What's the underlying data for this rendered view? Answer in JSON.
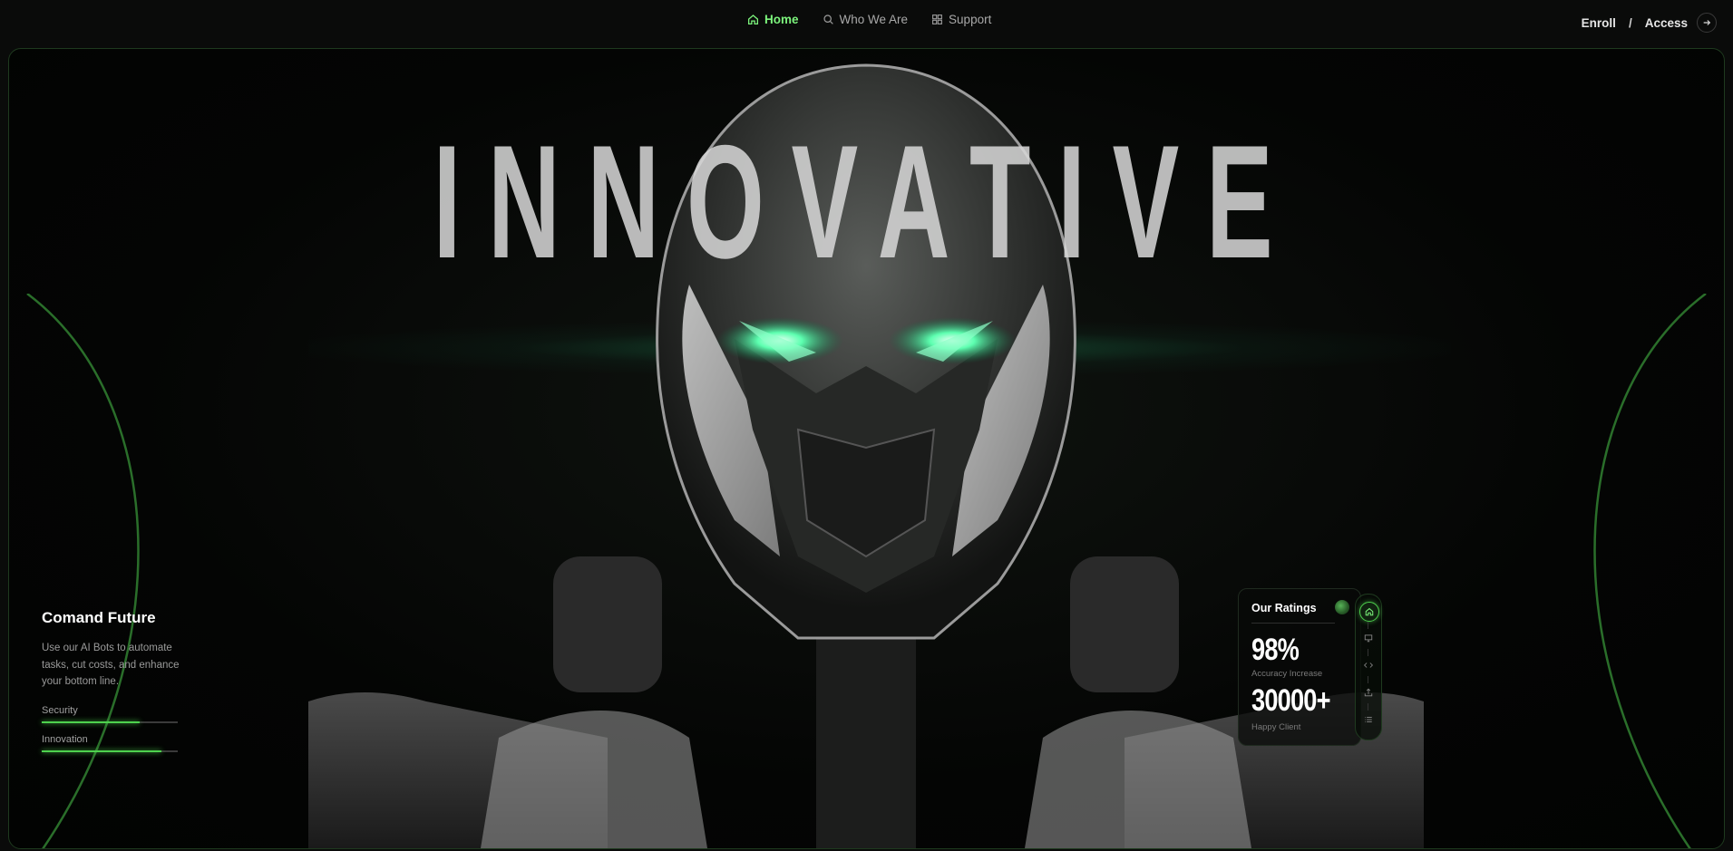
{
  "nav": {
    "items": [
      {
        "label": "Home",
        "icon": "home-icon",
        "active": true
      },
      {
        "label": "Who We Are",
        "icon": "search-icon",
        "active": false
      },
      {
        "label": "Support",
        "icon": "grid-icon",
        "active": false
      }
    ]
  },
  "auth": {
    "enroll": "Enroll",
    "separator": "/",
    "access": "Access",
    "arrow_icon": "arrow-right-icon"
  },
  "hero": {
    "headline": "INNOVATIVE"
  },
  "left_panel": {
    "title": "Comand Future",
    "description": "Use our AI Bots to automate tasks, cut costs, and enhance your bottom line.",
    "progress": [
      {
        "label": "Security",
        "value": 0.72
      },
      {
        "label": "Innovation",
        "value": 0.88
      }
    ]
  },
  "ratings": {
    "title": "Our Ratings",
    "stats": [
      {
        "value": "98%",
        "label": "Accuracy Increase"
      },
      {
        "value": "30000+",
        "label": "Happy Client"
      }
    ]
  },
  "rail": {
    "icons": [
      "home-icon",
      "monitor-icon",
      "code-icon",
      "share-icon",
      "list-icon"
    ],
    "active_index": 0
  },
  "colors": {
    "accent": "#4ed14e",
    "nav_active": "#7cf47c",
    "background": "#0a0b0a"
  }
}
